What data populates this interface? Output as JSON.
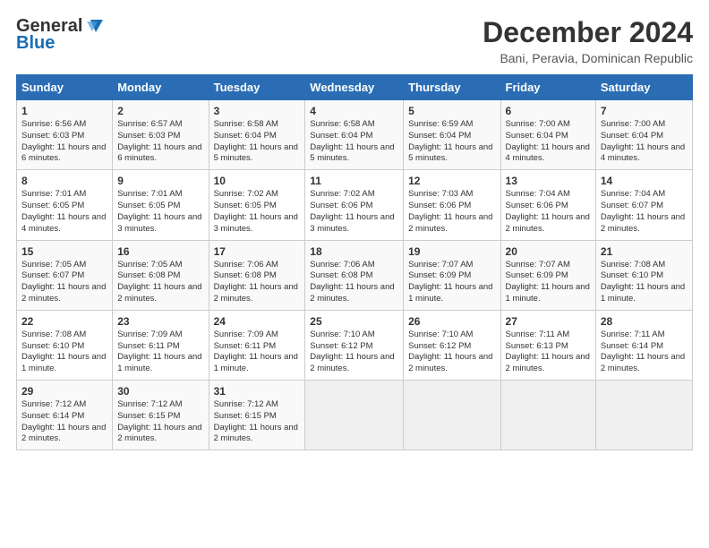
{
  "header": {
    "logo_line1": "General",
    "logo_line2": "Blue",
    "title": "December 2024",
    "location": "Bani, Peravia, Dominican Republic"
  },
  "days_of_week": [
    "Sunday",
    "Monday",
    "Tuesday",
    "Wednesday",
    "Thursday",
    "Friday",
    "Saturday"
  ],
  "weeks": [
    [
      {
        "day": "1",
        "info": "Sunrise: 6:56 AM\nSunset: 6:03 PM\nDaylight: 11 hours and 6 minutes."
      },
      {
        "day": "2",
        "info": "Sunrise: 6:57 AM\nSunset: 6:03 PM\nDaylight: 11 hours and 6 minutes."
      },
      {
        "day": "3",
        "info": "Sunrise: 6:58 AM\nSunset: 6:04 PM\nDaylight: 11 hours and 5 minutes."
      },
      {
        "day": "4",
        "info": "Sunrise: 6:58 AM\nSunset: 6:04 PM\nDaylight: 11 hours and 5 minutes."
      },
      {
        "day": "5",
        "info": "Sunrise: 6:59 AM\nSunset: 6:04 PM\nDaylight: 11 hours and 5 minutes."
      },
      {
        "day": "6",
        "info": "Sunrise: 7:00 AM\nSunset: 6:04 PM\nDaylight: 11 hours and 4 minutes."
      },
      {
        "day": "7",
        "info": "Sunrise: 7:00 AM\nSunset: 6:04 PM\nDaylight: 11 hours and 4 minutes."
      }
    ],
    [
      {
        "day": "8",
        "info": "Sunrise: 7:01 AM\nSunset: 6:05 PM\nDaylight: 11 hours and 4 minutes."
      },
      {
        "day": "9",
        "info": "Sunrise: 7:01 AM\nSunset: 6:05 PM\nDaylight: 11 hours and 3 minutes."
      },
      {
        "day": "10",
        "info": "Sunrise: 7:02 AM\nSunset: 6:05 PM\nDaylight: 11 hours and 3 minutes."
      },
      {
        "day": "11",
        "info": "Sunrise: 7:02 AM\nSunset: 6:06 PM\nDaylight: 11 hours and 3 minutes."
      },
      {
        "day": "12",
        "info": "Sunrise: 7:03 AM\nSunset: 6:06 PM\nDaylight: 11 hours and 2 minutes."
      },
      {
        "day": "13",
        "info": "Sunrise: 7:04 AM\nSunset: 6:06 PM\nDaylight: 11 hours and 2 minutes."
      },
      {
        "day": "14",
        "info": "Sunrise: 7:04 AM\nSunset: 6:07 PM\nDaylight: 11 hours and 2 minutes."
      }
    ],
    [
      {
        "day": "15",
        "info": "Sunrise: 7:05 AM\nSunset: 6:07 PM\nDaylight: 11 hours and 2 minutes."
      },
      {
        "day": "16",
        "info": "Sunrise: 7:05 AM\nSunset: 6:08 PM\nDaylight: 11 hours and 2 minutes."
      },
      {
        "day": "17",
        "info": "Sunrise: 7:06 AM\nSunset: 6:08 PM\nDaylight: 11 hours and 2 minutes."
      },
      {
        "day": "18",
        "info": "Sunrise: 7:06 AM\nSunset: 6:08 PM\nDaylight: 11 hours and 2 minutes."
      },
      {
        "day": "19",
        "info": "Sunrise: 7:07 AM\nSunset: 6:09 PM\nDaylight: 11 hours and 1 minute."
      },
      {
        "day": "20",
        "info": "Sunrise: 7:07 AM\nSunset: 6:09 PM\nDaylight: 11 hours and 1 minute."
      },
      {
        "day": "21",
        "info": "Sunrise: 7:08 AM\nSunset: 6:10 PM\nDaylight: 11 hours and 1 minute."
      }
    ],
    [
      {
        "day": "22",
        "info": "Sunrise: 7:08 AM\nSunset: 6:10 PM\nDaylight: 11 hours and 1 minute."
      },
      {
        "day": "23",
        "info": "Sunrise: 7:09 AM\nSunset: 6:11 PM\nDaylight: 11 hours and 1 minute."
      },
      {
        "day": "24",
        "info": "Sunrise: 7:09 AM\nSunset: 6:11 PM\nDaylight: 11 hours and 1 minute."
      },
      {
        "day": "25",
        "info": "Sunrise: 7:10 AM\nSunset: 6:12 PM\nDaylight: 11 hours and 2 minutes."
      },
      {
        "day": "26",
        "info": "Sunrise: 7:10 AM\nSunset: 6:12 PM\nDaylight: 11 hours and 2 minutes."
      },
      {
        "day": "27",
        "info": "Sunrise: 7:11 AM\nSunset: 6:13 PM\nDaylight: 11 hours and 2 minutes."
      },
      {
        "day": "28",
        "info": "Sunrise: 7:11 AM\nSunset: 6:14 PM\nDaylight: 11 hours and 2 minutes."
      }
    ],
    [
      {
        "day": "29",
        "info": "Sunrise: 7:12 AM\nSunset: 6:14 PM\nDaylight: 11 hours and 2 minutes."
      },
      {
        "day": "30",
        "info": "Sunrise: 7:12 AM\nSunset: 6:15 PM\nDaylight: 11 hours and 2 minutes."
      },
      {
        "day": "31",
        "info": "Sunrise: 7:12 AM\nSunset: 6:15 PM\nDaylight: 11 hours and 2 minutes."
      },
      null,
      null,
      null,
      null
    ]
  ]
}
